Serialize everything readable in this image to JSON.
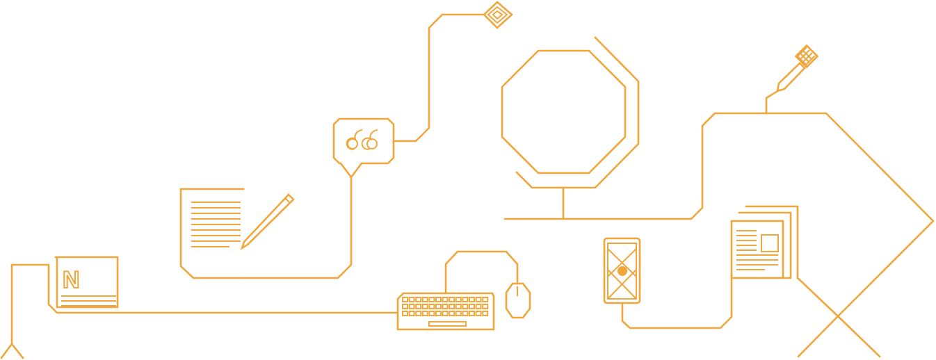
{
  "illustration": {
    "stroke_color": "#f0a63a",
    "background_color": "#ffffff",
    "notebook_letter": "N",
    "icons": [
      "antenna-icon",
      "notebook-icon",
      "document-pencil-icon",
      "quote-bubble-icon",
      "diamond-target-icon",
      "octagon-frame-icon",
      "keyboard-icon",
      "mouse-icon",
      "smartphone-icon",
      "newspaper-stack-icon",
      "microphone-icon"
    ]
  }
}
